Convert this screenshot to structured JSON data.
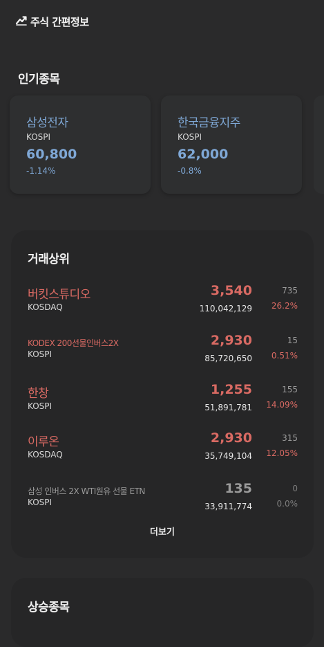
{
  "app": {
    "title": "주식 간편정보",
    "logo_icon": "chart-trend-icon"
  },
  "popular": {
    "title": "인기종목",
    "cards": [
      {
        "name": "삼성전자",
        "market": "KOSPI",
        "price": "60,800",
        "rate": "-1.14%"
      },
      {
        "name": "한국금융지주",
        "market": "KOSPI",
        "price": "62,000",
        "rate": "-0.8%"
      }
    ]
  },
  "top_trades": {
    "title": "거래상위",
    "rows": [
      {
        "name": "버킷스튜디오",
        "market": "KOSDAQ",
        "price": "3,540",
        "volume": "110,042,129",
        "change": "735",
        "rate": "26.2%"
      },
      {
        "name": "KODEX 200선물인버스2X",
        "market": "KOSPI",
        "price": "2,930",
        "volume": "85,720,650",
        "change": "15",
        "rate": "0.51%"
      },
      {
        "name": "한창",
        "market": "KOSPI",
        "price": "1,255",
        "volume": "51,891,781",
        "change": "155",
        "rate": "14.09%"
      },
      {
        "name": "이루온",
        "market": "KOSDAQ",
        "price": "2,930",
        "volume": "35,749,104",
        "change": "315",
        "rate": "12.05%"
      },
      {
        "name": "삼성 인버스 2X WTI원유 선물 ETN",
        "market": "KOSPI",
        "price": "135",
        "volume": "33,911,774",
        "change": "0",
        "rate": "0.0%"
      }
    ],
    "more_label": "더보기"
  },
  "rising": {
    "title": "상승종목"
  },
  "colors": {
    "background": "#2a2a2b",
    "panel": "#262627",
    "down_blue": "#7fa8d6",
    "up_red": "#d96a63",
    "flat_gray": "#9a9a9a"
  }
}
